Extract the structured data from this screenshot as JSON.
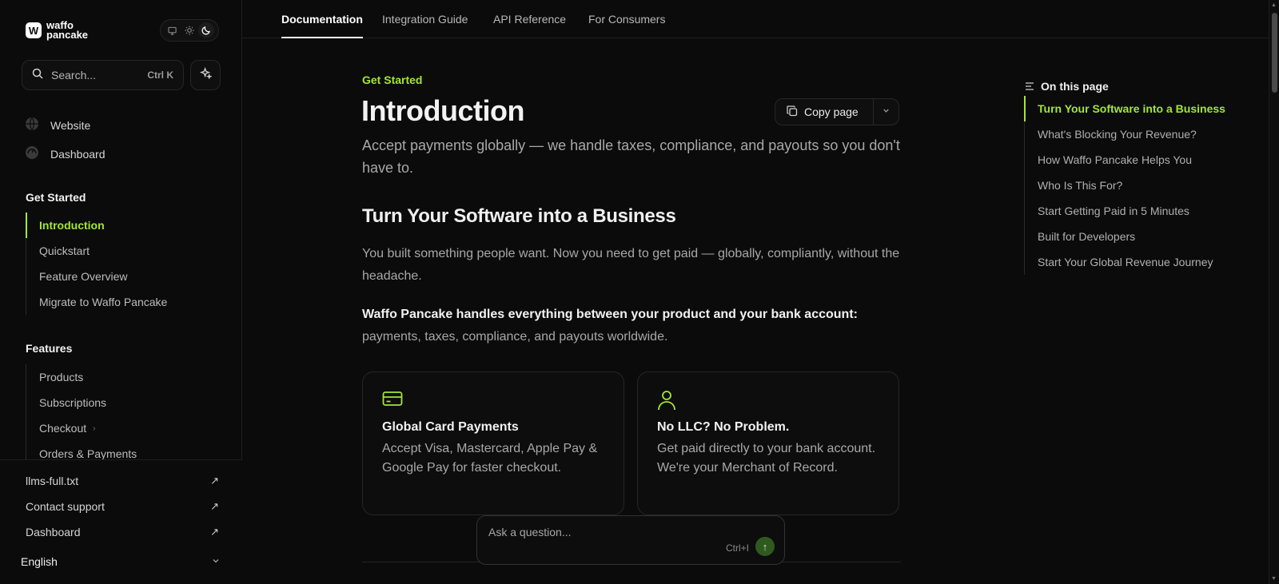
{
  "brand": {
    "line1": "waffo",
    "line2": "pancake",
    "mark": "W"
  },
  "theme": {
    "options": [
      "monitor-icon",
      "sun-icon",
      "moon-icon"
    ],
    "selected": "moon-icon"
  },
  "search": {
    "placeholder": "Search...",
    "shortcut": "Ctrl K"
  },
  "top_links": [
    {
      "label": "Website",
      "icon": "globe-icon"
    },
    {
      "label": "Dashboard",
      "icon": "dashboard-icon"
    }
  ],
  "sidebar": {
    "get_started_title": "Get Started",
    "get_started": [
      "Introduction",
      "Quickstart",
      "Feature Overview",
      "Migrate to Waffo Pancake"
    ],
    "features_title": "Features",
    "features": [
      "Products",
      "Subscriptions",
      "Checkout",
      "Orders & Payments"
    ]
  },
  "bottom_links": [
    "llms-full.txt",
    "Contact support",
    "Dashboard"
  ],
  "language": "English",
  "topnav": [
    "Documentation",
    "Integration Guide",
    "API Reference",
    "For Consumers"
  ],
  "page": {
    "eyebrow": "Get Started",
    "title": "Introduction",
    "copy_label": "Copy page",
    "lead": "Accept payments globally — we handle taxes, compliance, and payouts so you don't have to.",
    "h2": "Turn Your Software into a Business",
    "p1": "You built something people want. Now you need to get paid — globally, compliantly, without the headache.",
    "p2_strong": "Waffo Pancake handles everything between your product and your bank account:",
    "p2_rest": " payments, taxes, compliance, and payouts worldwide.",
    "cards": [
      {
        "icon": "credit-card-icon",
        "title": "Global Card Payments",
        "desc": "Accept Visa, Mastercard, Apple Pay & Google Pay for faster checkout."
      },
      {
        "icon": "user-icon",
        "title": "No LLC? No Problem.",
        "desc": "Get paid directly to your bank account. We're your Merchant of Record."
      }
    ]
  },
  "ask": {
    "placeholder": "Ask a question...",
    "shortcut": "Ctrl+I"
  },
  "toc": {
    "title": "On this page",
    "items": [
      "Turn Your Software into a Business",
      "What's Blocking Your Revenue?",
      "How Waffo Pancake Helps You",
      "Who Is This For?",
      "Start Getting Paid in 5 Minutes",
      "Built for Developers",
      "Start Your Global Revenue Journey"
    ]
  },
  "colors": {
    "accent": "#a3e635",
    "background": "#0b0b0b",
    "border": "#262626"
  }
}
